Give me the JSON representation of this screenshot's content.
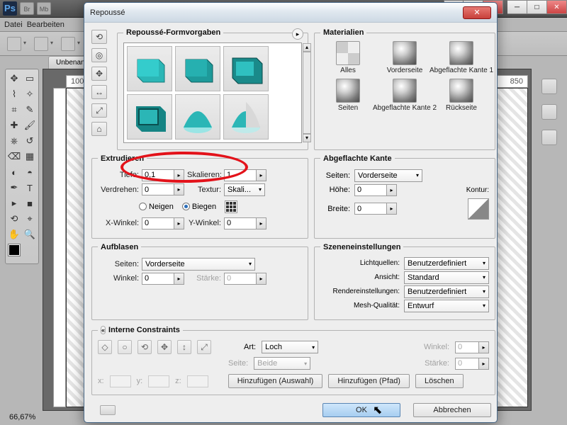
{
  "appMenu": {
    "file": "Datei",
    "edit": "Bearbeiten"
  },
  "docTab": "Unbenan",
  "rulerMarks": [
    "100",
    "850"
  ],
  "zoom": "66,67%",
  "dialog": {
    "title": "Repoussé",
    "presetsTitle": "Repoussé-Formvorgaben",
    "materialsTitle": "Materialien",
    "materials": [
      "Alles",
      "Vorderseite",
      "Abgeflachte Kante 1",
      "Seiten",
      "Abgeflachte Kante 2",
      "Rückseite"
    ],
    "extrude": {
      "title": "Extrudieren",
      "depthLabel": "Tiefe:",
      "depthValue": "0,1",
      "scaleLabel": "Skalieren:",
      "scaleValue": "1",
      "twistLabel": "Verdrehen:",
      "twistValue": "0",
      "textureLabel": "Textur:",
      "textureValue": "Skali...",
      "radioTilt": "Neigen",
      "radioBend": "Biegen",
      "xAngleLabel": "X-Winkel:",
      "xAngleValue": "0",
      "yAngleLabel": "Y-Winkel:",
      "yAngleValue": "0"
    },
    "bevel": {
      "title": "Abgeflachte Kante",
      "sidesLabel": "Seiten:",
      "sidesValue": "Vorderseite",
      "heightLabel": "Höhe:",
      "heightValue": "0",
      "widthLabel": "Breite:",
      "widthValue": "0",
      "contourLabel": "Kontur:"
    },
    "inflate": {
      "title": "Aufblasen",
      "sidesLabel": "Seiten:",
      "sidesValue": "Vorderseite",
      "angleLabel": "Winkel:",
      "angleValue": "0",
      "strengthLabel": "Stärke:",
      "strengthValue": "0"
    },
    "scene": {
      "title": "Szeneneinstellungen",
      "lightsLabel": "Lichtquellen:",
      "lightsValue": "Benutzerdefiniert",
      "viewLabel": "Ansicht:",
      "viewValue": "Standard",
      "renderLabel": "Rendereinstellungen:",
      "renderValue": "Benutzerdefiniert",
      "meshLabel": "Mesh-Qualität:",
      "meshValue": "Entwurf"
    },
    "constraints": {
      "title": "Interne Constraints",
      "typeLabel": "Art:",
      "typeValue": "Loch",
      "sideLabel": "Seite:",
      "sideValue": "Beide",
      "angleLabel": "Winkel:",
      "angleValue": "0",
      "strengthLabel": "Stärke:",
      "strengthValue": "0",
      "xLabel": "x:",
      "yLabel": "y:",
      "zLabel": "z:",
      "addSel": "Hinzufügen (Auswahl)",
      "addPath": "Hinzufügen (Pfad)",
      "delete": "Löschen"
    },
    "ok": "OK",
    "cancel": "Abbrechen"
  }
}
